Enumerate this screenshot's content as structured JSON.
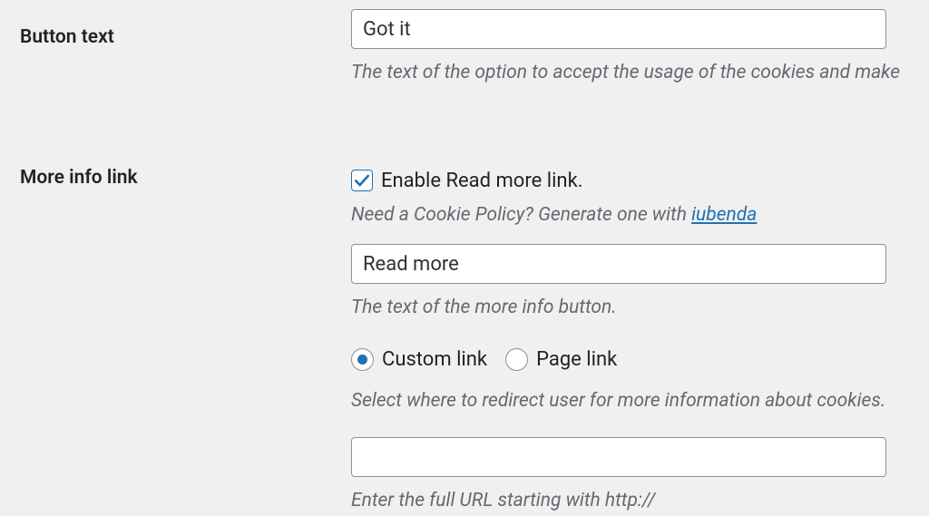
{
  "buttonText": {
    "label": "Button text",
    "value": "Got it",
    "description": "The text of the option to accept the usage of the cookies and make"
  },
  "moreInfo": {
    "label": "More info link",
    "enableCheckbox": {
      "checked": true,
      "label": "Enable Read more link."
    },
    "policyHint": {
      "prefix": "Need a Cookie Policy? Generate one with ",
      "linkText": "iubenda"
    },
    "readMoreText": {
      "value": "Read more",
      "description": "The text of the more info button."
    },
    "linkType": {
      "options": {
        "custom": "Custom link",
        "page": "Page link"
      },
      "selected": "custom",
      "description": "Select where to redirect user for more information about cookies."
    },
    "urlInput": {
      "value": "",
      "description": "Enter the full URL starting with http://"
    }
  }
}
